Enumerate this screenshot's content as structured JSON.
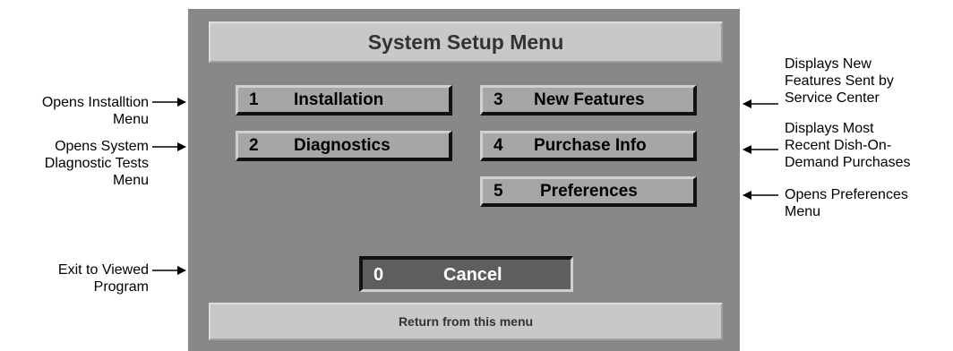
{
  "menu": {
    "title": "System Setup Menu",
    "buttons": [
      {
        "num": "1",
        "label": "Installation"
      },
      {
        "num": "2",
        "label": "Diagnostics"
      },
      {
        "num": "3",
        "label": "New Features"
      },
      {
        "num": "4",
        "label": "Purchase Info"
      },
      {
        "num": "5",
        "label": "Preferences"
      }
    ],
    "cancel": {
      "num": "0",
      "label": "Cancel"
    },
    "status": "Return from this menu"
  },
  "callouts": {
    "installation": [
      "Opens Installtion",
      "Menu"
    ],
    "diagnostics": [
      "Opens System",
      "Dlagnostic Tests",
      "Menu"
    ],
    "cancel": [
      "Exit to Viewed",
      "Program"
    ],
    "new_features": [
      "Displays New",
      "Features Sent by",
      "Service Center"
    ],
    "purchase_info": [
      "Displays Most",
      "Recent Dish-On-",
      "Demand Purchases"
    ],
    "preferences": [
      "Opens Preferences",
      "Menu"
    ]
  }
}
